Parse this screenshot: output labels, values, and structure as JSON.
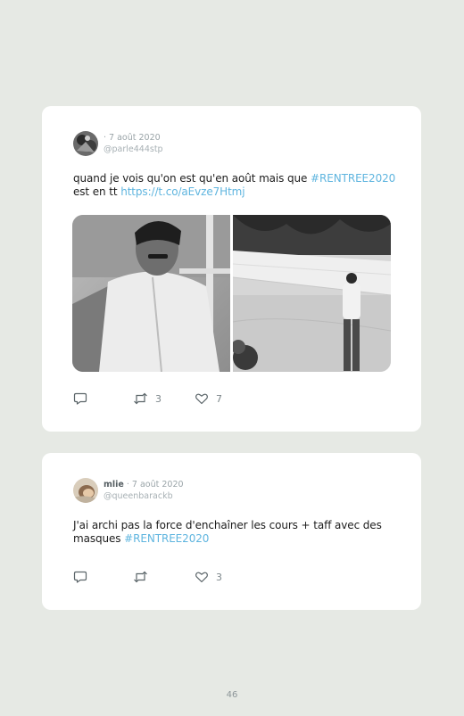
{
  "tweets": [
    {
      "name": "",
      "date": "· 7 août 2020",
      "handle": "@parle444stp",
      "text_parts": [
        "quand je vois qu'on est qu'en août mais que ",
        "#RENTREE2020",
        " est en tt ",
        "https://t.co/aEvze7Htmj"
      ],
      "retweets": "3",
      "likes": "7",
      "media": [
        "pablo-escobar-sitting",
        "pablo-escobar-standing"
      ]
    },
    {
      "name": "mlie",
      "date": " · 7 août 2020",
      "handle": "@queenbarackb",
      "text_parts": [
        "J'ai archi pas la force d'enchaîner les cours + taff avec des masques ",
        "#RENTREE2020"
      ],
      "retweets": "",
      "likes": "3"
    }
  ],
  "icons": {
    "reply": "comment-icon",
    "retweet": "retweet-icon",
    "like": "heart-icon"
  },
  "colors": {
    "link": "#5fb5df",
    "background": "#e6e9e4",
    "card": "#ffffff"
  },
  "page_number": "46"
}
